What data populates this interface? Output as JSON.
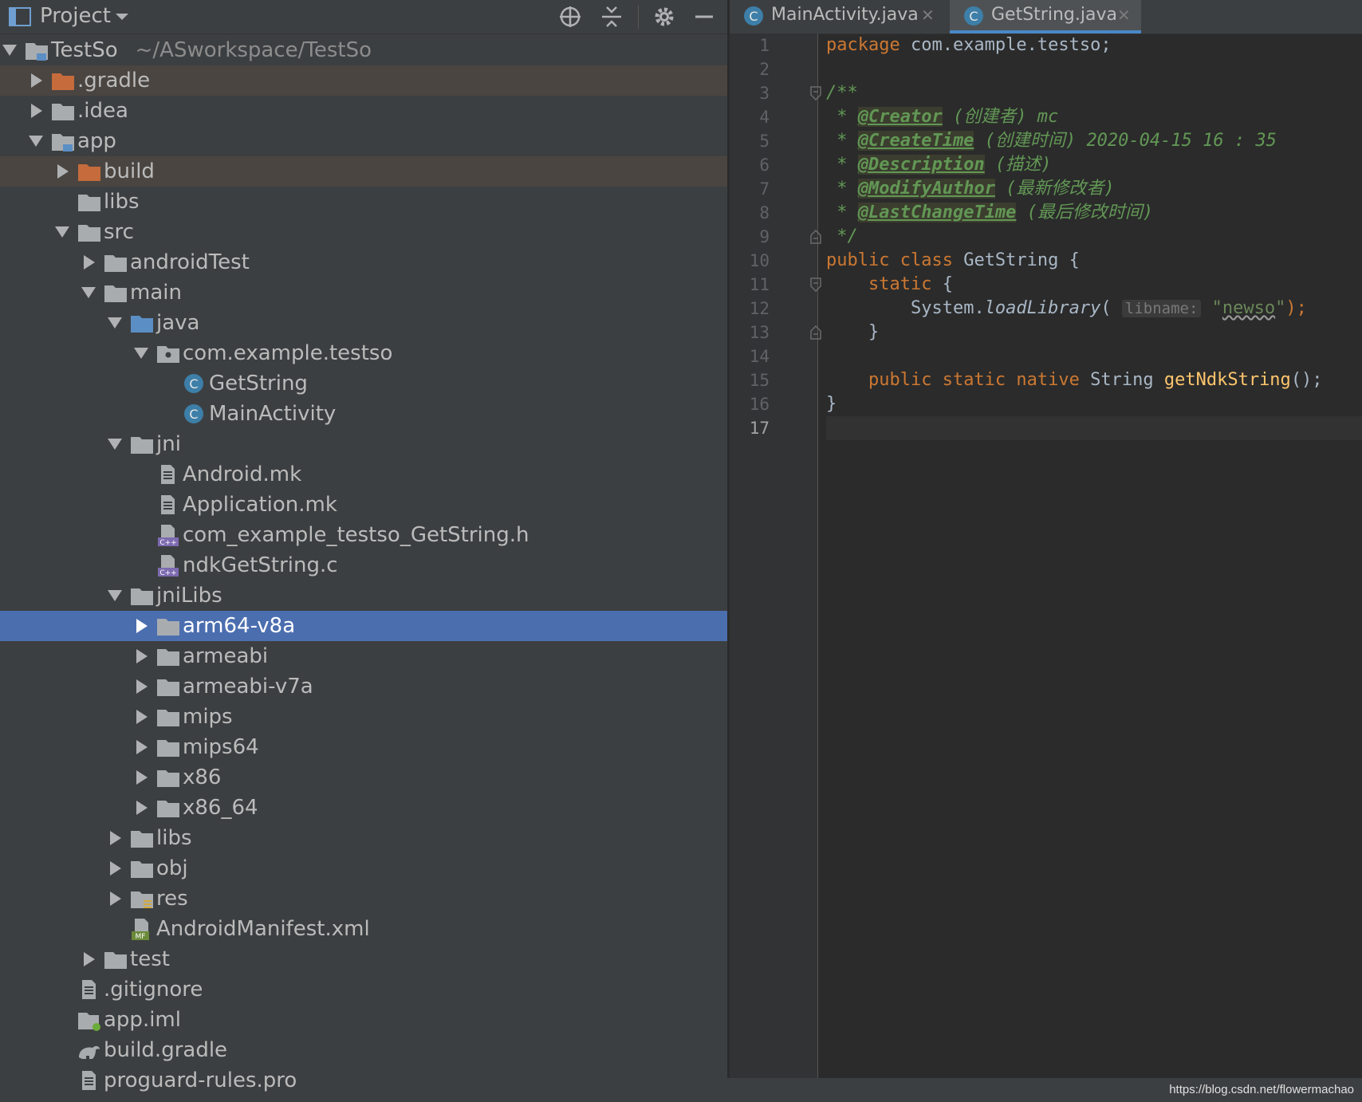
{
  "project_panel": {
    "title": "Project",
    "tree": [
      {
        "label": "TestSo",
        "path": "~/ASworkspace/TestSo",
        "icon": "module-folder-icon",
        "depth": 0,
        "expanded": true
      },
      {
        "label": ".gradle",
        "icon": "orange-folder-icon",
        "depth": 1,
        "expanded": false,
        "excluded": true
      },
      {
        "label": ".idea",
        "icon": "folder-icon",
        "depth": 1,
        "expanded": false
      },
      {
        "label": "app",
        "icon": "module-folder-icon",
        "depth": 1,
        "expanded": true
      },
      {
        "label": "build",
        "icon": "orange-folder-icon",
        "depth": 2,
        "expanded": false,
        "excluded": true
      },
      {
        "label": "libs",
        "icon": "folder-icon",
        "depth": 2
      },
      {
        "label": "src",
        "icon": "folder-icon",
        "depth": 2,
        "expanded": true
      },
      {
        "label": "androidTest",
        "icon": "folder-icon",
        "depth": 3,
        "expanded": false
      },
      {
        "label": "main",
        "icon": "folder-icon",
        "depth": 3,
        "expanded": true
      },
      {
        "label": "java",
        "icon": "source-folder-icon",
        "depth": 4,
        "expanded": true
      },
      {
        "label": "com.example.testso",
        "icon": "package-icon",
        "depth": 5,
        "expanded": true
      },
      {
        "label": "GetString",
        "icon": "class-icon",
        "depth": 6
      },
      {
        "label": "MainActivity",
        "icon": "class-icon",
        "depth": 6
      },
      {
        "label": "jni",
        "icon": "folder-icon",
        "depth": 4,
        "expanded": true
      },
      {
        "label": "Android.mk",
        "icon": "text-file-icon",
        "depth": 5
      },
      {
        "label": "Application.mk",
        "icon": "text-file-icon",
        "depth": 5
      },
      {
        "label": "com_example_testso_GetString.h",
        "icon": "cpp-file-icon",
        "depth": 5
      },
      {
        "label": "ndkGetString.c",
        "icon": "cpp-file-icon",
        "depth": 5
      },
      {
        "label": "jniLibs",
        "icon": "folder-icon",
        "depth": 4,
        "expanded": true
      },
      {
        "label": "arm64-v8a",
        "icon": "folder-icon",
        "depth": 5,
        "expanded": false,
        "selected": true
      },
      {
        "label": "armeabi",
        "icon": "folder-icon",
        "depth": 5,
        "expanded": false
      },
      {
        "label": "armeabi-v7a",
        "icon": "folder-icon",
        "depth": 5,
        "expanded": false
      },
      {
        "label": "mips",
        "icon": "folder-icon",
        "depth": 5,
        "expanded": false
      },
      {
        "label": "mips64",
        "icon": "folder-icon",
        "depth": 5,
        "expanded": false
      },
      {
        "label": "x86",
        "icon": "folder-icon",
        "depth": 5,
        "expanded": false
      },
      {
        "label": "x86_64",
        "icon": "folder-icon",
        "depth": 5,
        "expanded": false
      },
      {
        "label": "libs",
        "icon": "folder-icon",
        "depth": 4,
        "expanded": false
      },
      {
        "label": "obj",
        "icon": "folder-icon",
        "depth": 4,
        "expanded": false
      },
      {
        "label": "res",
        "icon": "resource-folder-icon",
        "depth": 4,
        "expanded": false
      },
      {
        "label": "AndroidManifest.xml",
        "icon": "manifest-file-icon",
        "depth": 4
      },
      {
        "label": "test",
        "icon": "folder-icon",
        "depth": 3,
        "expanded": false
      },
      {
        "label": ".gitignore",
        "icon": "text-file-icon",
        "depth": 2
      },
      {
        "label": "app.iml",
        "icon": "module-file-icon",
        "depth": 2
      },
      {
        "label": "build.gradle",
        "icon": "gradle-icon",
        "depth": 2
      },
      {
        "label": "proguard-rules.pro",
        "icon": "text-file-icon",
        "depth": 2
      }
    ]
  },
  "editor": {
    "tabs": [
      {
        "label": "MainActivity.java",
        "icon": "class-icon",
        "active": false
      },
      {
        "label": "GetString.java",
        "icon": "class-icon",
        "active": true
      }
    ],
    "line_numbers": [
      "1",
      "2",
      "3",
      "4",
      "5",
      "6",
      "7",
      "8",
      "9",
      "10",
      "11",
      "12",
      "13",
      "14",
      "15",
      "16",
      "17"
    ],
    "current_line": "17",
    "code": {
      "l1": {
        "kw": "package",
        "rest": " com.example.testso;"
      },
      "l3": "/**",
      "l4": {
        "star": " * ",
        "tag": "@Creator",
        "text": " (创建者) mc"
      },
      "l5": {
        "star": " * ",
        "tag": "@CreateTime",
        "text": " (创建时间) ",
        "date": "2020-04-15 16 : 35"
      },
      "l6": {
        "star": " * ",
        "tag": "@Description",
        "text": " (描述)"
      },
      "l7": {
        "star": " * ",
        "tag": "@ModifyAuthor",
        "text": " (最新修改者)"
      },
      "l8": {
        "star": " * ",
        "tag": "@LastChangeTime",
        "text": " (最后修改时间)"
      },
      "l9": " */",
      "l10": {
        "kw": "public class",
        "rest": " GetString {"
      },
      "l11": {
        "indent": "    ",
        "kw": "static",
        "rest": " {"
      },
      "l12": {
        "indent": "        ",
        "obj": "System.",
        "method": "loadLibrary",
        "open": "(",
        "hint": "libname:",
        "q1": "\"",
        "str": "newso",
        "q2": "\"",
        "close": ");"
      },
      "l13": "    }",
      "l15": {
        "indent": "    ",
        "kw": "public static native",
        "type": " String ",
        "fn": "getNdkString",
        "rest": "();"
      },
      "l16": "}"
    }
  },
  "watermark": "https://blog.csdn.net/flowermachao"
}
